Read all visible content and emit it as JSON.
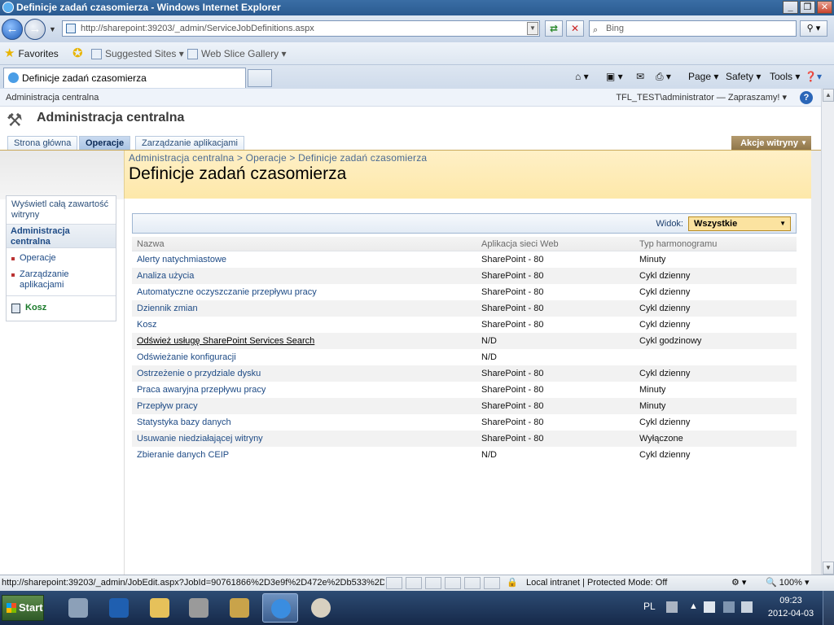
{
  "window": {
    "title": "Definicje zadań czasomierza - Windows Internet Explorer",
    "min_label": "_",
    "max_label": "❐",
    "close_label": "✕"
  },
  "address_bar": {
    "url": "http://sharepoint:39203/_admin/ServiceJobDefinitions.aspx",
    "search_placeholder": "Bing"
  },
  "favorites_bar": {
    "favorites_label": "Favorites",
    "suggested_sites_label": "Suggested Sites ▾",
    "web_slice_label": "Web Slice Gallery ▾"
  },
  "tab": {
    "label": "Definicje zadań czasomierza"
  },
  "command_bar": {
    "page_label": "Page ▾",
    "safety_label": "Safety ▾",
    "tools_label": "Tools ▾"
  },
  "sharepoint": {
    "top_left": "Administracja centralna",
    "user_welcome": "TFL_TEST\\administrator — Zapraszamy! ▾",
    "site_title": "Administracja centralna",
    "nav_tabs": [
      {
        "label": "Strona główna"
      },
      {
        "label": "Operacje"
      },
      {
        "label": "Zarządzanie aplikacjami"
      }
    ],
    "site_actions": "Akcje witryny",
    "breadcrumb": "Administracja centralna > Operacje > Definicje zadań czasomierza",
    "page_title": "Definicje zadań czasomierza",
    "left_nav": {
      "view_all": "Wyświetl całą zawartość witryny",
      "heading": "Administracja centralna",
      "items": [
        "Operacje",
        "Zarządzanie aplikacjami"
      ],
      "recycle_bin": "Kosz"
    },
    "view": {
      "label": "Widok:",
      "selected": "Wszystkie"
    },
    "table": {
      "headers": [
        "Nazwa",
        "Aplikacja sieci Web",
        "Typ harmonogramu"
      ],
      "rows": [
        [
          "Alerty natychmiastowe",
          "SharePoint - 80",
          "Minuty"
        ],
        [
          "Analiza użycia",
          "SharePoint - 80",
          "Cykl dzienny"
        ],
        [
          "Automatyczne oczyszczanie przepływu pracy",
          "SharePoint - 80",
          "Cykl dzienny"
        ],
        [
          "Dziennik zmian",
          "SharePoint - 80",
          "Cykl dzienny"
        ],
        [
          "Kosz",
          "SharePoint - 80",
          "Cykl dzienny"
        ],
        [
          "Odśwież usługę SharePoint Services Search",
          "N/D",
          "Cykl godzinowy"
        ],
        [
          "Odświeżanie konfiguracji",
          "N/D",
          ""
        ],
        [
          "Ostrzeżenie o przydziale dysku",
          "SharePoint - 80",
          "Cykl dzienny"
        ],
        [
          "Praca awaryjna przepływu pracy",
          "SharePoint - 80",
          "Minuty"
        ],
        [
          "Przepływ pracy",
          "SharePoint - 80",
          "Minuty"
        ],
        [
          "Statystyka bazy danych",
          "SharePoint - 80",
          "Cykl dzienny"
        ],
        [
          "Usuwanie niedziałającej witryny",
          "SharePoint - 80",
          "Wyłączone"
        ],
        [
          "Zbieranie danych CEIP",
          "N/D",
          "Cykl dzienny"
        ]
      ]
    }
  },
  "status_bar": {
    "url": "http://sharepoint:39203/_admin/JobEdit.aspx?JobId=90761866%2D3e9f%2D472e%2Db533%2D",
    "zone": "Local intranet | Protected Mode: Off",
    "zoom": "100%"
  },
  "taskbar": {
    "start_label": "Start",
    "lang": "PL",
    "time": "09:23",
    "date": "2012-04-03"
  },
  "colors": {
    "accent": "#2a66b8",
    "title_area": "#fde8a9",
    "site_actions": "#8e7448"
  }
}
